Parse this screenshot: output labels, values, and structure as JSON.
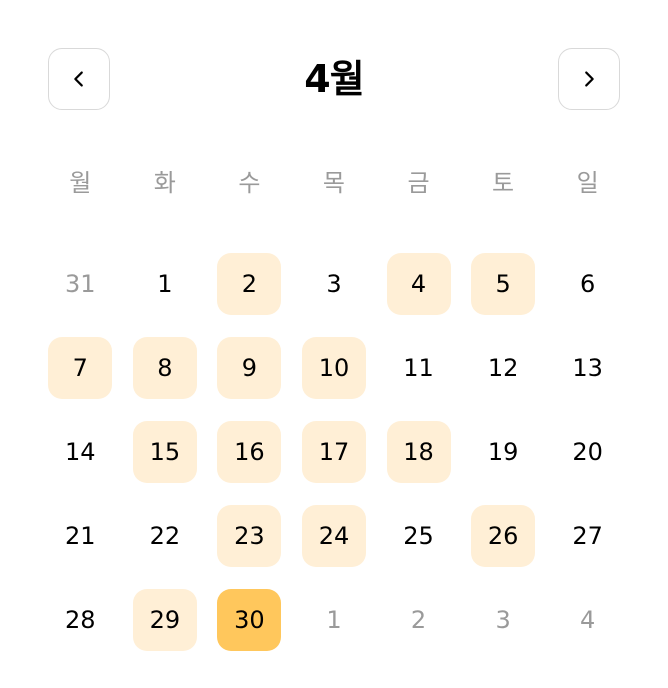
{
  "header": {
    "title": "4월",
    "prev_icon": "chevron-left-icon",
    "next_icon": "chevron-right-icon"
  },
  "weekdays": [
    "월",
    "화",
    "수",
    "목",
    "금",
    "토",
    "일"
  ],
  "colors": {
    "marked": "#ffefd6",
    "selected": "#ffc75c",
    "muted_text": "#9a9a9a",
    "border": "#d9d9d9"
  },
  "weeks": [
    [
      {
        "label": "31",
        "state": "other"
      },
      {
        "label": "1",
        "state": "normal"
      },
      {
        "label": "2",
        "state": "marked"
      },
      {
        "label": "3",
        "state": "normal"
      },
      {
        "label": "4",
        "state": "marked"
      },
      {
        "label": "5",
        "state": "marked"
      },
      {
        "label": "6",
        "state": "normal"
      }
    ],
    [
      {
        "label": "7",
        "state": "marked"
      },
      {
        "label": "8",
        "state": "marked"
      },
      {
        "label": "9",
        "state": "marked"
      },
      {
        "label": "10",
        "state": "marked"
      },
      {
        "label": "11",
        "state": "normal"
      },
      {
        "label": "12",
        "state": "normal"
      },
      {
        "label": "13",
        "state": "normal"
      }
    ],
    [
      {
        "label": "14",
        "state": "normal"
      },
      {
        "label": "15",
        "state": "marked"
      },
      {
        "label": "16",
        "state": "marked"
      },
      {
        "label": "17",
        "state": "marked"
      },
      {
        "label": "18",
        "state": "marked"
      },
      {
        "label": "19",
        "state": "normal"
      },
      {
        "label": "20",
        "state": "normal"
      }
    ],
    [
      {
        "label": "21",
        "state": "normal"
      },
      {
        "label": "22",
        "state": "normal"
      },
      {
        "label": "23",
        "state": "marked"
      },
      {
        "label": "24",
        "state": "marked"
      },
      {
        "label": "25",
        "state": "normal"
      },
      {
        "label": "26",
        "state": "marked"
      },
      {
        "label": "27",
        "state": "normal"
      }
    ],
    [
      {
        "label": "28",
        "state": "normal"
      },
      {
        "label": "29",
        "state": "marked"
      },
      {
        "label": "30",
        "state": "selected"
      },
      {
        "label": "1",
        "state": "other"
      },
      {
        "label": "2",
        "state": "other"
      },
      {
        "label": "3",
        "state": "other"
      },
      {
        "label": "4",
        "state": "other"
      }
    ]
  ]
}
